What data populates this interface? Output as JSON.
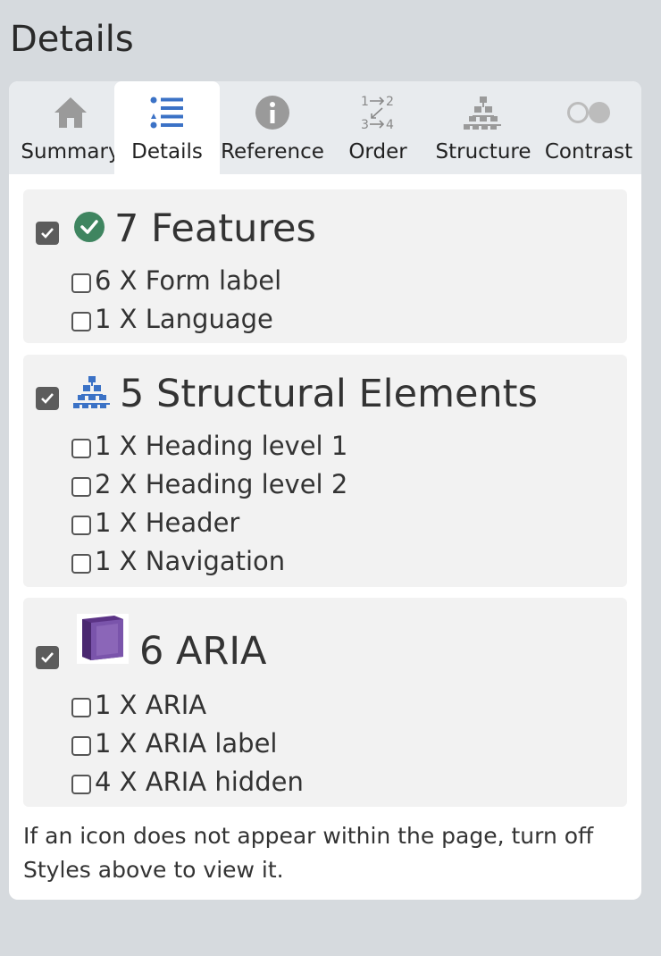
{
  "page": {
    "title": "Details"
  },
  "tabs": [
    {
      "label": "Summary",
      "icon": "home-icon"
    },
    {
      "label": "Details",
      "icon": "list-icon",
      "active": true
    },
    {
      "label": "Reference",
      "icon": "info-icon"
    },
    {
      "label": "Order",
      "icon": "order-icon",
      "icon_text": [
        "1",
        "2",
        "3",
        "4"
      ]
    },
    {
      "label": "Structure",
      "icon": "structure-icon"
    },
    {
      "label": "Contrast",
      "icon": "contrast-icon"
    }
  ],
  "sections": [
    {
      "title": "7 Features",
      "icon": "check-circle-icon",
      "checked": true,
      "items": [
        {
          "label": "6 X Form label",
          "checked": false
        },
        {
          "label": "1 X Language",
          "checked": false
        }
      ]
    },
    {
      "title": "5 Structural Elements",
      "icon": "structure-icon",
      "checked": true,
      "items": [
        {
          "label": "1 X Heading level 1",
          "checked": false
        },
        {
          "label": "2 X Heading level 2",
          "checked": false
        },
        {
          "label": "1 X Header",
          "checked": false
        },
        {
          "label": "1 X Navigation",
          "checked": false
        }
      ]
    },
    {
      "title": "6 ARIA",
      "icon": "aria-cube-icon",
      "checked": true,
      "items": [
        {
          "label": "1 X ARIA",
          "checked": false
        },
        {
          "label": "1 X ARIA label",
          "checked": false
        },
        {
          "label": "4 X ARIA hidden",
          "checked": false
        }
      ]
    }
  ],
  "footer": {
    "note": "If an icon does not appear within the page, turn off Styles above to view it."
  },
  "colors": {
    "background": "#d6dade",
    "tab_bar": "#e8ebee",
    "section_bg": "#f2f2f2",
    "check_green": "#3f8560",
    "structure_blue": "#3b72c6",
    "aria_purple": "#5b3386",
    "tab_icon_gray": "#9a9a9a"
  }
}
